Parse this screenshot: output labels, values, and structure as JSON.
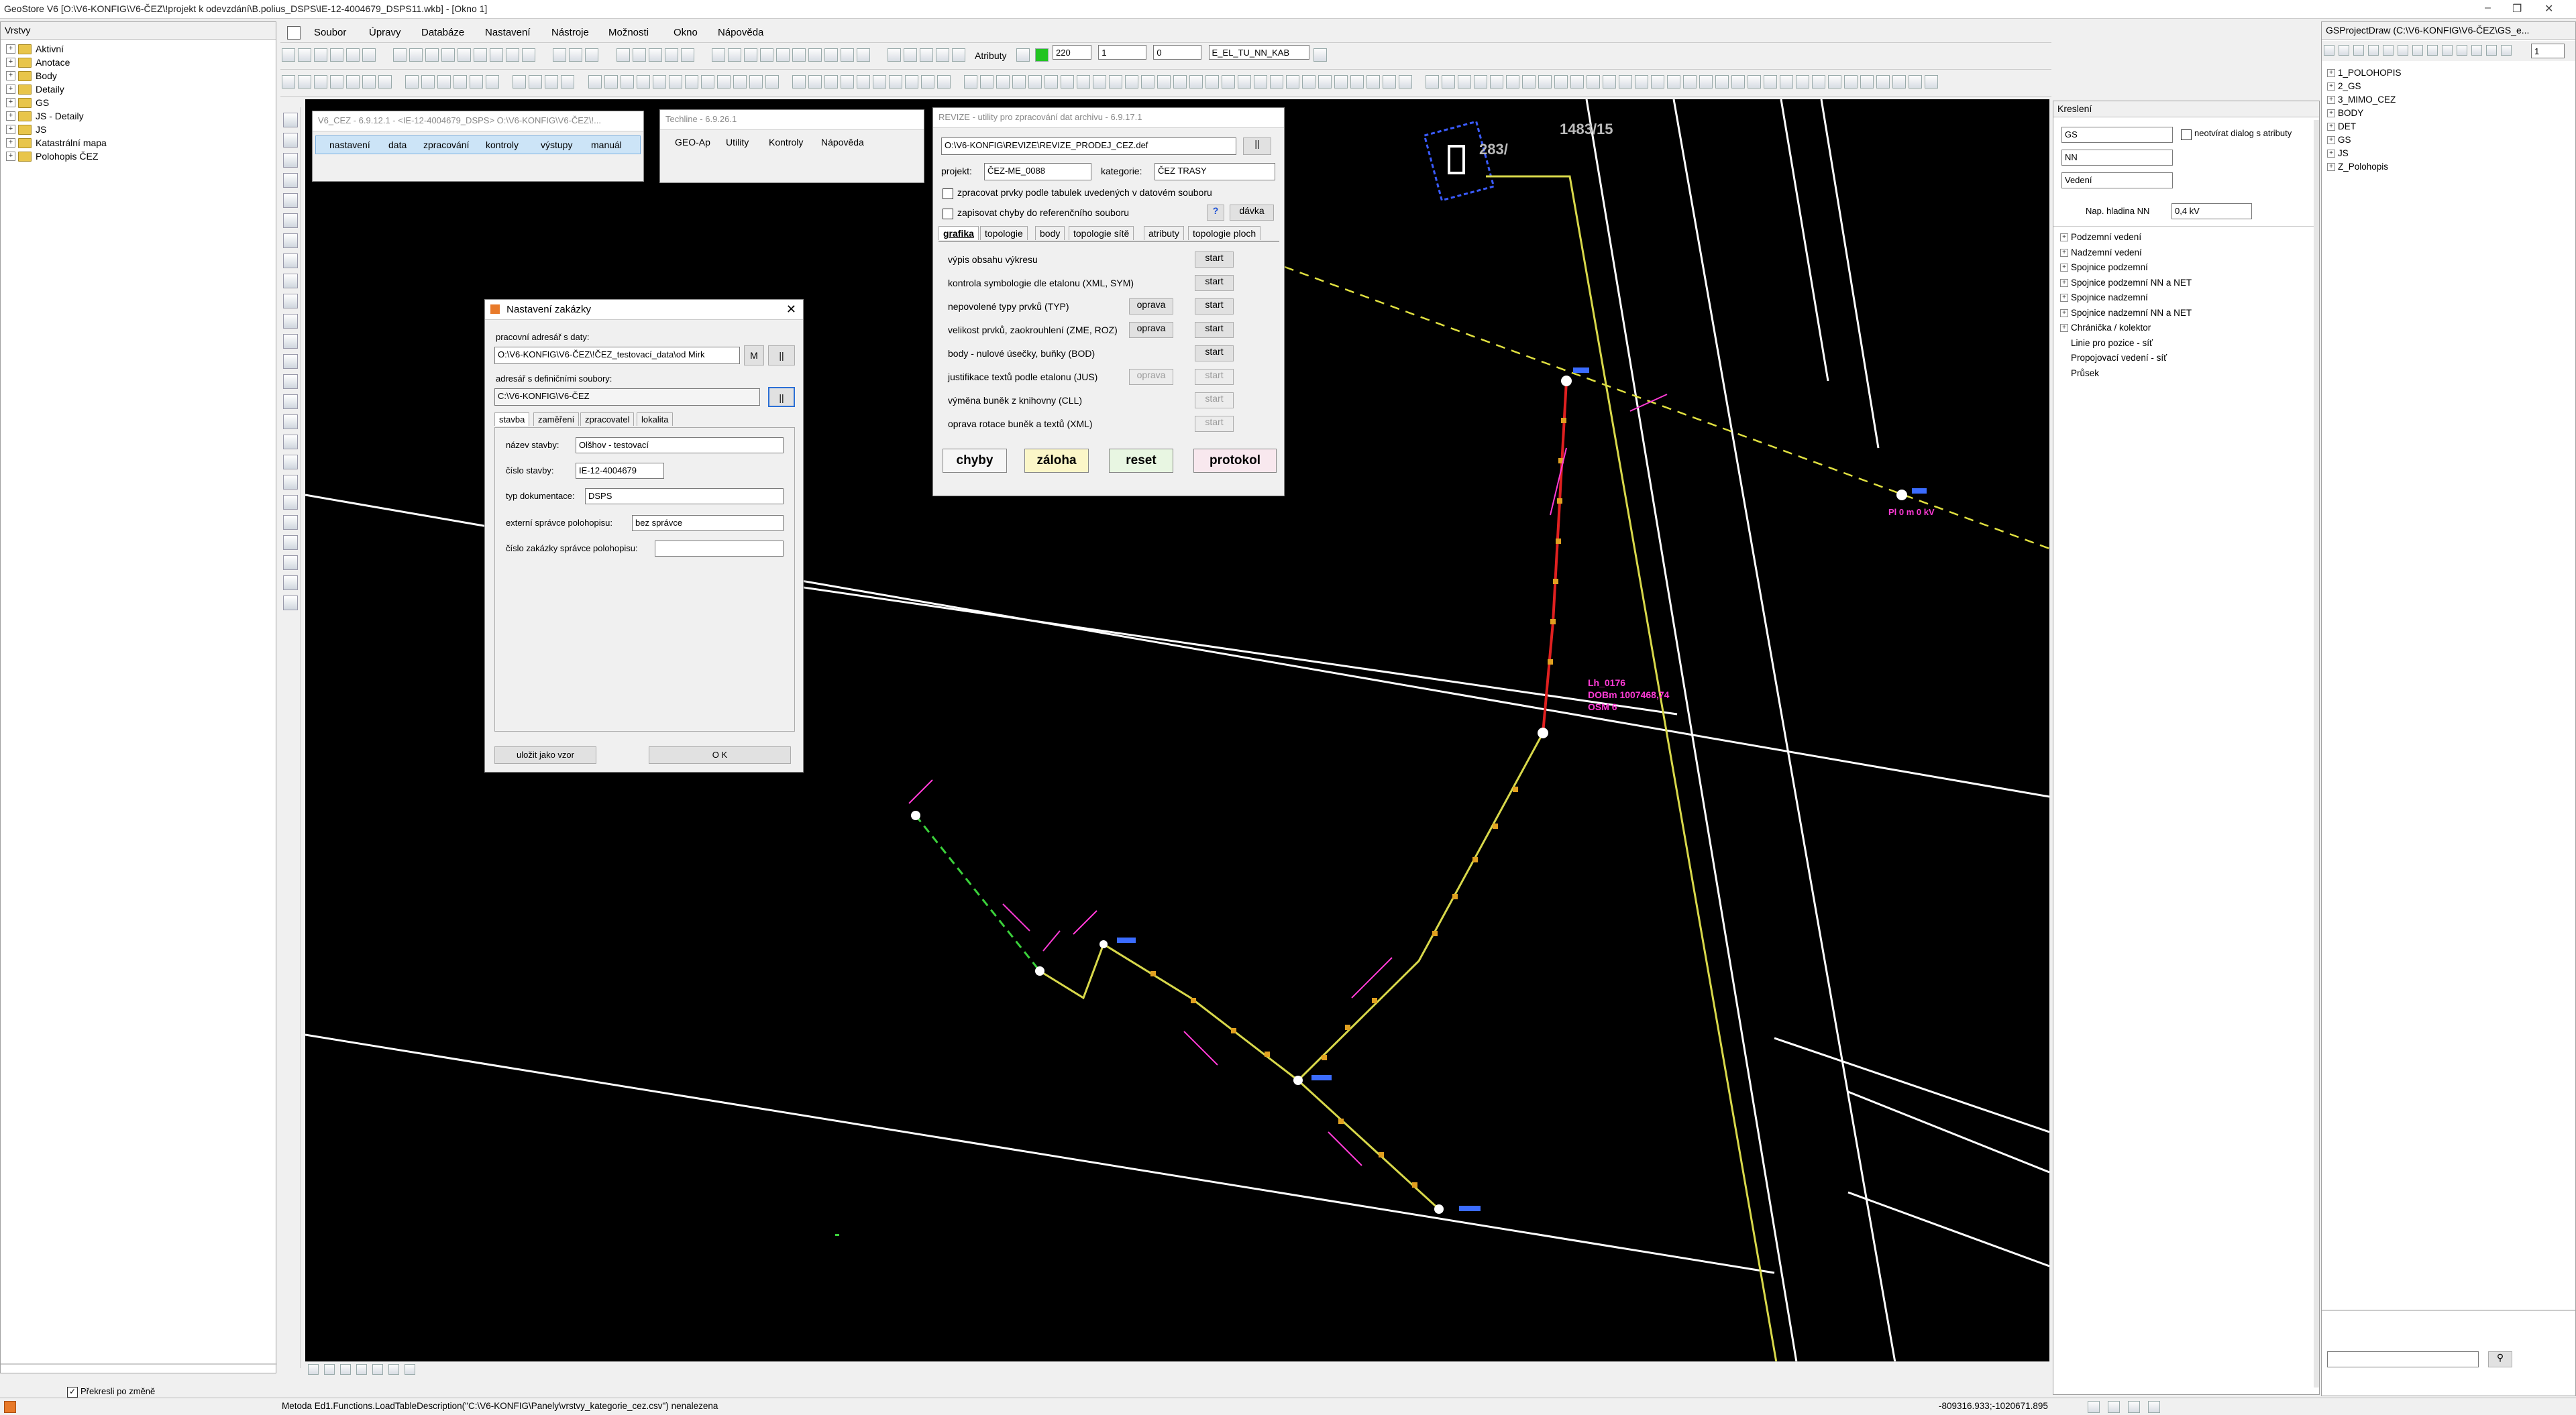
{
  "window": {
    "title": "GeoStore V6 [O:\\V6-KONFIG\\V6-ČEZ\\!projekt k odevzdání\\B.polius_DSPS\\IE-12-4004679_DSPS11.wkb] - [Okno 1]",
    "controls": [
      "–",
      "❐",
      "✕"
    ]
  },
  "menu": {
    "items": [
      "Soubor",
      "Úpravy",
      "Databáze",
      "Nastavení",
      "Nástroje",
      "Možnosti",
      "Okno",
      "Nápověda"
    ]
  },
  "layers_panel": {
    "title": "Vrstvy",
    "items": [
      "Aktivní",
      "Anotace",
      "Body",
      "Detaily",
      "GS",
      "JS - Detaily",
      "JS",
      "Katastrální mapa",
      "Polohopis ČEZ"
    ],
    "redraw_checkbox_label": "Překresli po změně",
    "redraw_checked": true
  },
  "toolbar": {
    "attributes_label": "Atributy",
    "scale_value": "220",
    "line_value_1": "1",
    "line_value_2": "0",
    "style_value": "E_EL_TU_NN_KAB"
  },
  "v6cez_window": {
    "title": "V6_CEZ - 6.9.12.1 - <IE-12-4004679_DSPS> O:\\V6-KONFIG\\V6-ČEZ\\!...",
    "menu": [
      "nastavení",
      "data",
      "zpracování",
      "kontroly",
      "výstupy",
      "manuál"
    ]
  },
  "techline_window": {
    "title": "Techline - 6.9.26.1",
    "menu": [
      "GEO-Ap",
      "Utility",
      "Kontroly",
      "Nápověda"
    ]
  },
  "revize_window": {
    "title": "REVIZE - utility pro zpracování dat archivu - 6.9.17.1",
    "path": "O:\\V6-KONFIG\\REVIZE\\REVIZE_PRODEJ_CEZ.def",
    "project_label": "projekt:",
    "project_value": "ČEZ-ME_0088",
    "category_label": "kategorie:",
    "category_value": "ČEZ TRASY",
    "check1_label": "zpracovat prvky podle tabulek uvedených v datovém souboru",
    "check2_label": "zapisovat chyby do referenčního souboru",
    "help_btn": "?",
    "batch_btn": "dávka",
    "tabs": [
      "grafika",
      "topologie",
      "body",
      "topologie sítě",
      "atributy",
      "topologie ploch"
    ],
    "rows": [
      {
        "label": "výpis obsahu výkresu",
        "fix": "",
        "start": "start",
        "enabled": true
      },
      {
        "label": "kontrola symbologie dle etalonu (XML, SYM)",
        "fix": "",
        "start": "start",
        "enabled": true
      },
      {
        "label": "nepovolené typy prvků (TYP)",
        "fix": "oprava",
        "start": "start",
        "enabled": true
      },
      {
        "label": "velikost prvků, zaokrouhlení (ZME, ROZ)",
        "fix": "oprava",
        "start": "start",
        "enabled": true
      },
      {
        "label": "body - nulové úsečky, buňky (BOD)",
        "fix": "",
        "start": "start",
        "enabled": true
      },
      {
        "label": "justifikace textů podle etalonu (JUS)",
        "fix": "oprava",
        "start": "start",
        "enabled": false
      },
      {
        "label": "výměna buněk z knihovny (CLL)",
        "fix": "",
        "start": "start",
        "enabled": false
      },
      {
        "label": "oprava rotace buněk a textů (XML)",
        "fix": "",
        "start": "start",
        "enabled": false
      }
    ],
    "buttons": [
      "chyby",
      "záloha",
      "reset",
      "protokol"
    ]
  },
  "nastaveni_dialog": {
    "title": "Nastavení zakázky",
    "data_dir_label": "pracovní adresář s daty:",
    "data_dir_value": "O:\\V6-KONFIG\\V6-ČEZ\\!ČEZ_testovací_data\\od Mirk",
    "m_btn": "M",
    "def_dir_label": "adresář s definičními soubory:",
    "def_dir_value": "C:\\V6-KONFIG\\V6-ČEZ",
    "tabs": [
      "stavba",
      "zaměření",
      "zpracovatel",
      "lokalita"
    ],
    "fields": {
      "name_label": "název stavby:",
      "name_value": "Olšhov - testovací",
      "number_label": "číslo stavby:",
      "number_value": "IE-12-4004679",
      "doc_type_label": "typ dokumentace:",
      "doc_type_value": "DSPS",
      "ext_admin_label": "externí správce polohopisu:",
      "ext_admin_value": "bez správce",
      "order_label": "číslo zakázky správce polohopisu:",
      "order_value": ""
    },
    "save_btn": "uložit jako vzor",
    "ok_btn": "O K"
  },
  "project_panel": {
    "title": "GSProjectDraw (C:\\V6-KONFIG\\V6-ČEZ\\GS_e...",
    "spin_value": "1",
    "tree": [
      "1_POLOHOPIS",
      "2_GS",
      "3_MIMO_CEZ",
      "BODY",
      "DET",
      "GS",
      "JS",
      "Z_Polohopis"
    ]
  },
  "kresleni_panel": {
    "title": "Kreslení",
    "combo1": "GS",
    "combo2": "NN",
    "combo3": "Vedení",
    "no_attr_dialog_label": "neotvírat dialog s atributy",
    "voltage_label": "Nap. hladina NN",
    "voltage_value": "0,4 kV",
    "items": [
      "Podzemní vedení",
      "Nadzemní vedení",
      "Spojnice podzemní",
      "Spojnice podzemní NN a NET",
      "Spojnice nadzemní",
      "Spojnice nadzemní NN a NET",
      "Chránička / kolektor",
      "Linie pro pozice - síť",
      "Propojovací vedení - síť",
      "Průsek"
    ]
  },
  "map": {
    "parcel_labels": [
      "1483/15",
      "283/"
    ],
    "annotation_1": "Lh_0176",
    "annotation_2": "DOBm 1007468,74",
    "annotation_3": "OSM 6",
    "annotation_4": "Pl 0 m 0 kV"
  },
  "status": {
    "message": "Metoda Ed1.Functions.LoadTableDescription(\"C:\\V6-KONFIG\\Panely\\vrstvy_kategorie_cez.csv\") nenalezena",
    "coords": "-809316.933;-1020671.895"
  },
  "colors": {
    "map_background": "#000000",
    "route_yellow": "#d8d84a",
    "route_red": "#e02020",
    "magenta_text": "#ff3bd6",
    "green_dashed": "#3bd13b",
    "yellow_dashed": "#e0e040",
    "zaloha_bg": "#fbf6c8",
    "reset_bg": "#e8f6e2",
    "protokol_bg": "#f8e8ee",
    "selected_menu_bg": "#cce4f7"
  }
}
